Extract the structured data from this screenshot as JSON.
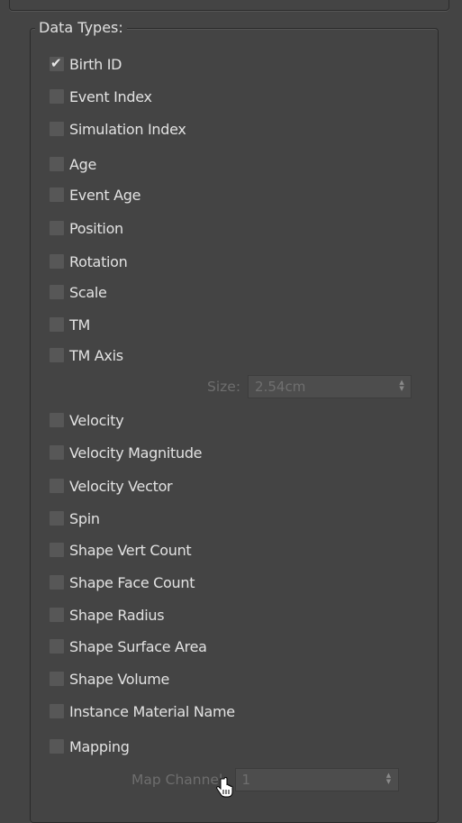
{
  "group_title": "Data Types:",
  "items": [
    {
      "label": "Birth ID",
      "checked": true
    },
    {
      "label": "Event Index",
      "checked": false
    },
    {
      "label": "Simulation Index",
      "checked": false
    },
    {
      "label": "Age",
      "checked": false
    },
    {
      "label": "Event Age",
      "checked": false
    },
    {
      "label": "Position",
      "checked": false
    },
    {
      "label": "Rotation",
      "checked": false
    },
    {
      "label": "Scale",
      "checked": false
    },
    {
      "label": "TM",
      "checked": false
    },
    {
      "label": "TM Axis",
      "checked": false
    },
    {
      "label": "Velocity",
      "checked": false
    },
    {
      "label": "Velocity Magnitude",
      "checked": false
    },
    {
      "label": "Velocity Vector",
      "checked": false
    },
    {
      "label": "Spin",
      "checked": false
    },
    {
      "label": "Shape Vert Count",
      "checked": false
    },
    {
      "label": "Shape Face Count",
      "checked": false
    },
    {
      "label": "Shape Radius",
      "checked": false
    },
    {
      "label": "Shape Surface Area",
      "checked": false
    },
    {
      "label": "Shape Volume",
      "checked": false
    },
    {
      "label": "Instance Material Name",
      "checked": false
    },
    {
      "label": "Mapping",
      "checked": false
    }
  ],
  "size_param": {
    "label": "Size:",
    "value": "2.54cm"
  },
  "map_channel_param": {
    "label": "Map Channel:",
    "value": "1"
  },
  "colors": {
    "background": "#444444",
    "checkbox": "#575757",
    "disabled_text": "#6e6e6e"
  }
}
